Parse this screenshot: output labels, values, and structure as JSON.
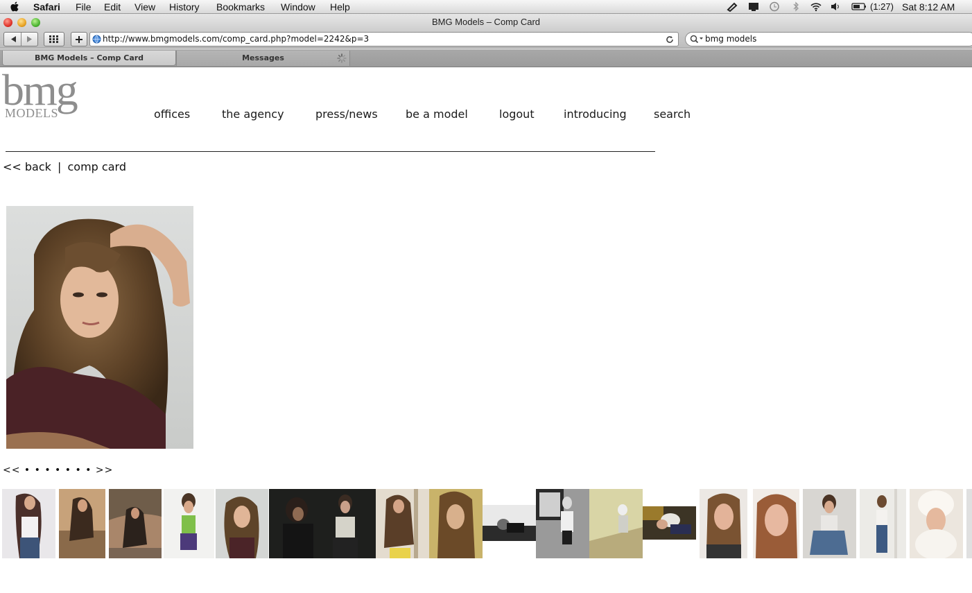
{
  "menubar": {
    "app_name": "Safari",
    "items": [
      "File",
      "Edit",
      "View",
      "History",
      "Bookmarks",
      "Window",
      "Help"
    ],
    "battery_text": "(1:27)",
    "clock": "Sat 8:12 AM"
  },
  "window": {
    "title": "BMG Models – Comp Card"
  },
  "toolbar": {
    "url": "http://www.bmgmodels.com/comp_card.php?model=2242&p=3",
    "search_value": "bmg models"
  },
  "tabs": [
    {
      "label": "BMG Models – Comp Card",
      "active": true
    },
    {
      "label": "Messages",
      "active": false,
      "loading": true
    }
  ],
  "site": {
    "logo_main": "bmg",
    "logo_sub": "MODELS",
    "nav": [
      "offices",
      "the agency",
      "press/news",
      "be a model",
      "logout",
      "introducing",
      "search"
    ],
    "back_link": "<< back",
    "separator": "|",
    "section": "comp card",
    "pager_prev": "<<",
    "pager_dots": "• • • • • • •",
    "pager_next": ">>"
  },
  "colors": {
    "logo_gray": "#8e8e8e",
    "text": "#111111",
    "divider": "#222222"
  }
}
